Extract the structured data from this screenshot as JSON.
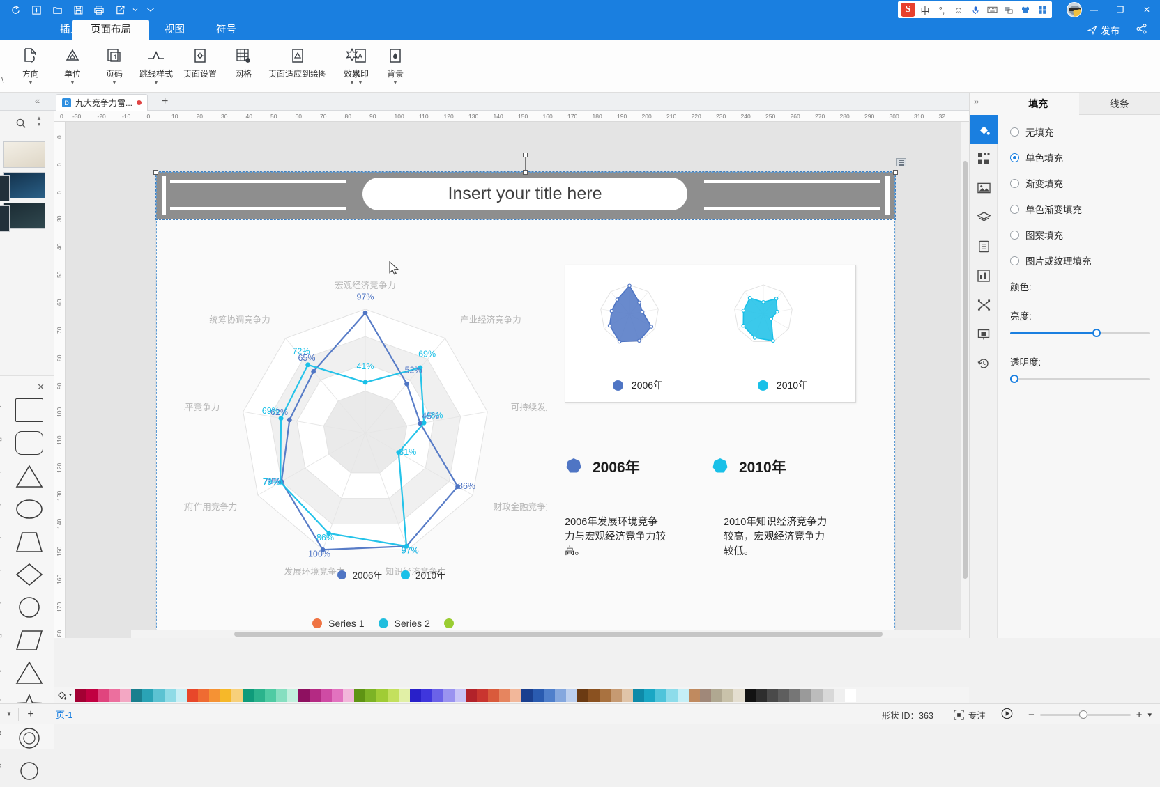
{
  "titlebar": {
    "quick_actions": [
      "redo-icon",
      "new-icon",
      "open-icon",
      "save-icon",
      "print-icon",
      "export-icon",
      "more-icon"
    ],
    "ime": {
      "lang": "中",
      "tone": "°,",
      "emoji": "☺",
      "mic": "mic-icon",
      "keyboard": "keyboard-icon",
      "tool": "tool-icon",
      "skin": "skin-icon",
      "grid": "grid-icon",
      "logo": "S"
    },
    "window_controls": [
      "—",
      "❐",
      "✕"
    ]
  },
  "ribbon": {
    "tabs": [
      {
        "label": "插入",
        "active": false
      },
      {
        "label": "页面布局",
        "active": true
      },
      {
        "label": "视图",
        "active": false
      },
      {
        "label": "符号",
        "active": false
      }
    ],
    "publish_label": "发布",
    "items": [
      {
        "label": "方向",
        "icon": "orientation-icon",
        "caret": true
      },
      {
        "label": "单位",
        "icon": "unit-icon",
        "caret": true
      },
      {
        "label": "页码",
        "icon": "page-number-icon",
        "caret": true
      },
      {
        "label": "跳线样式",
        "icon": "jump-line-icon",
        "caret": true
      },
      {
        "label": "页面设置",
        "icon": "page-setup-icon",
        "caret": false
      },
      {
        "label": "网格",
        "icon": "grid-icon",
        "caret": false
      },
      {
        "label": "页面适应到绘图",
        "icon": "fit-page-icon",
        "caret": false
      },
      {
        "label": "效果",
        "icon": "effects-icon",
        "caret": true
      },
      {
        "label": "水印",
        "icon": "watermark-icon",
        "caret": true
      },
      {
        "label": "背景",
        "icon": "background-icon",
        "caret": true
      }
    ]
  },
  "doc_tab": {
    "title": "九大竞争力雷...",
    "modified": true,
    "add_label": "+"
  },
  "right_panel": {
    "tabs": [
      {
        "label": "填充",
        "active": true
      },
      {
        "label": "线条",
        "active": false
      }
    ],
    "fill_options": [
      {
        "label": "无填充",
        "selected": false
      },
      {
        "label": "单色填充",
        "selected": true
      },
      {
        "label": "渐变填充",
        "selected": false
      },
      {
        "label": "单色渐变填充",
        "selected": false
      },
      {
        "label": "图案填充",
        "selected": false
      },
      {
        "label": "图片或纹理填充",
        "selected": false
      }
    ],
    "color_label": "颜色:",
    "brightness_label": "亮度:",
    "brightness_value": 62,
    "transparency_label": "透明度:",
    "transparency_value": 2,
    "icons": [
      "fill-bucket-icon",
      "shapes-icon",
      "image-icon",
      "layers-icon",
      "document-icon",
      "chart-icon",
      "shuffle-icon",
      "present-icon",
      "history-icon"
    ]
  },
  "canvas": {
    "banner_title": "Insert your title here",
    "card_legend": [
      {
        "label": "2006年",
        "color": "#4f75c4"
      },
      {
        "label": "2010年",
        "color": "#19c0e8"
      }
    ],
    "years": [
      {
        "label": "2006年",
        "color": "#4f75c4",
        "desc": "2006年发展环境竞争力与宏观经济竞争力较高。"
      },
      {
        "label": "2010年",
        "color": "#19c0e8",
        "desc": "2010年知识经济竞争力较高，宏观经济竞争力较低。"
      }
    ],
    "series_legend": [
      {
        "label": "Series 1",
        "color": "#ef7343"
      },
      {
        "label": "Series 2",
        "color": "#21bede"
      },
      {
        "label": "",
        "color": "#9acd32"
      }
    ]
  },
  "chart_data": {
    "type": "radar",
    "title": "九大竞争力雷达图",
    "categories": [
      "宏观经济竞争力",
      "产业经济竞争力",
      "可持续发展竞争力",
      "财政金融竞争力",
      "知识经济竞争力",
      "发展环境竞争力",
      "政府作用竞争力",
      "发展水平竞争力",
      "统筹协调竞争力"
    ],
    "series": [
      {
        "name": "2006年",
        "color": "#4f75c4",
        "values": [
          97,
          52,
          45,
          86,
          97,
          100,
          78,
          62,
          65
        ],
        "labels": [
          "97%",
          "52%",
          "45%",
          "86%",
          "97%",
          "100%",
          "78%",
          "62%",
          "65%"
        ]
      },
      {
        "name": "2010年",
        "color": "#19c0e8",
        "values": [
          41,
          69,
          48,
          31,
          97,
          86,
          79,
          69,
          72
        ],
        "labels": [
          "41%",
          "69%",
          "48%",
          "31%",
          "97%",
          "86%",
          "79%",
          "69%",
          "72%"
        ]
      }
    ],
    "ylim": [
      0,
      100
    ],
    "grid": true,
    "legend_position": "bottom"
  },
  "status_bar": {
    "page_label": "页-1",
    "shape_id_label": "形状 ID：363",
    "focus_label": "专注",
    "zoom_minus": "−",
    "zoom_plus": "+",
    "zoom_value": 43
  },
  "rulers": {
    "h_ticks": [
      "0",
      "-30",
      "-20",
      "-10",
      "0",
      "10",
      "20",
      "30",
      "40",
      "50",
      "60",
      "70",
      "80",
      "90",
      "100",
      "110",
      "120",
      "130",
      "140",
      "150",
      "160",
      "170",
      "180",
      "190",
      "200",
      "210",
      "220",
      "230",
      "240",
      "250",
      "260",
      "270",
      "280",
      "290",
      "300",
      "310",
      "32"
    ],
    "v_ticks": [
      "0",
      "0",
      "0",
      "30",
      "40",
      "50",
      "60",
      "70",
      "80",
      "90",
      "100",
      "110",
      "120",
      "130",
      "140",
      "150",
      "160",
      "170",
      "180"
    ]
  }
}
